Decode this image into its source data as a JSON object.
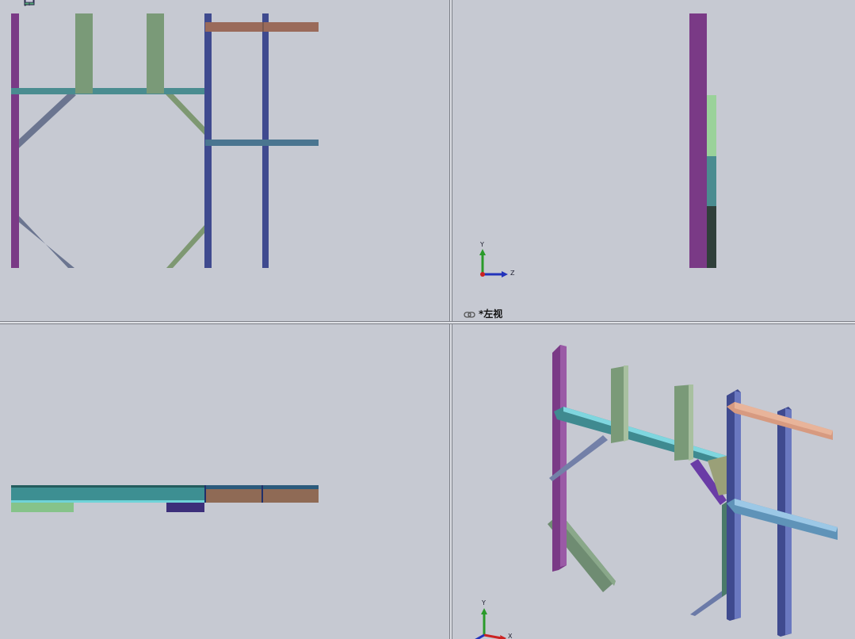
{
  "viewports": {
    "top_left": {
      "label": ""
    },
    "top_right": {
      "label": "*左视"
    },
    "bottom_left": {
      "label": ""
    },
    "bottom_right": {
      "label": ""
    }
  },
  "triad_top_right": {
    "y": "Y",
    "z": "Z"
  },
  "triad_bottom_right": {
    "y": "Y",
    "x": "X"
  },
  "toolbar": {
    "icons": [
      "zoom-to-fit-icon",
      "zoom-area-icon",
      "previous-view-icon",
      "section-view-icon",
      "view-orientation-icon",
      "display-style-icon",
      "hide-show-icon",
      "edit-appearance-icon",
      "apply-scene-icon",
      "view-settings-icon"
    ]
  },
  "colors": {
    "background": "#c6c9d2",
    "purple": "#7a3a86",
    "green": "#7a9a78",
    "teal": "#4a8c90",
    "blue": "#3f4a8f",
    "brown": "#9a6a5a"
  }
}
